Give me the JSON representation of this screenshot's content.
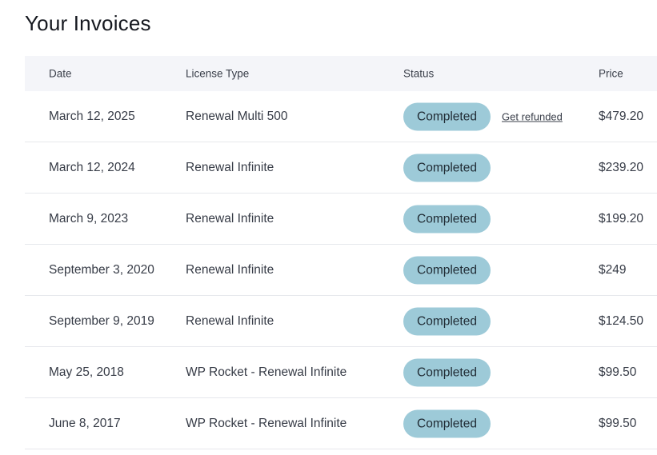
{
  "page": {
    "title": "Your Invoices"
  },
  "table": {
    "headers": {
      "date": "Date",
      "license_type": "License Type",
      "status": "Status",
      "price": "Price"
    },
    "rows": [
      {
        "date": "March 12, 2025",
        "license_type": "Renewal Multi 500",
        "status": "Completed",
        "price": "$479.20",
        "action": "Get refunded"
      },
      {
        "date": "March 12, 2024",
        "license_type": "Renewal Infinite",
        "status": "Completed",
        "price": "$239.20"
      },
      {
        "date": "March 9, 2023",
        "license_type": "Renewal Infinite",
        "status": "Completed",
        "price": "$199.20"
      },
      {
        "date": "September 3, 2020",
        "license_type": "Renewal Infinite",
        "status": "Completed",
        "price": "$249"
      },
      {
        "date": "September 9, 2019",
        "license_type": "Renewal Infinite",
        "status": "Completed",
        "price": "$124.50"
      },
      {
        "date": "May 25, 2018",
        "license_type": "WP Rocket - Renewal Infinite",
        "status": "Completed",
        "price": "$99.50"
      },
      {
        "date": "June 8, 2017",
        "license_type": "WP Rocket - Renewal Infinite",
        "status": "Completed",
        "price": "$99.50"
      }
    ]
  },
  "colors": {
    "status_badge_bg": "#9dcad8",
    "header_bg": "#f4f5f9"
  }
}
